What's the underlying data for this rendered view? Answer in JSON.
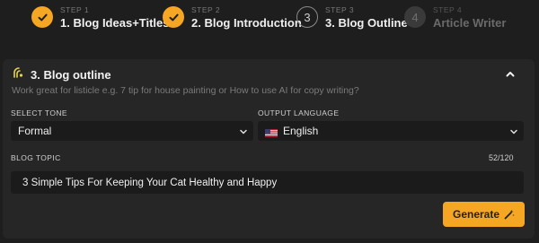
{
  "stepper": {
    "steps": [
      {
        "label": "STEP 1",
        "title": "1. Blog Ideas+Titles",
        "state": "done"
      },
      {
        "label": "STEP 2",
        "title": "2. Blog Introduction",
        "state": "done"
      },
      {
        "label": "STEP 3",
        "title": "3. Blog Outline",
        "state": "current",
        "number": "3"
      },
      {
        "label": "STEP 4",
        "title": "Article Writer",
        "state": "pending",
        "number": "4"
      }
    ]
  },
  "card": {
    "title": "3. Blog outline",
    "hint": "Work great for listicle e.g. 7 tip for house painting or How to use AI for copy writing?",
    "tone": {
      "label": "SELECT TONE",
      "value": "Formal"
    },
    "language": {
      "label": "OUTPUT LANGUAGE",
      "value": "English"
    },
    "topic": {
      "label": "BLOG TOPIC",
      "counter": "52/120",
      "value": "3 Simple Tips For Keeping Your Cat Healthy and Happy"
    },
    "generate_label": "Generate"
  },
  "colors": {
    "accent": "#f5a623",
    "background": "#1e1e1e",
    "card": "#262626",
    "field": "#1b1b1b"
  }
}
